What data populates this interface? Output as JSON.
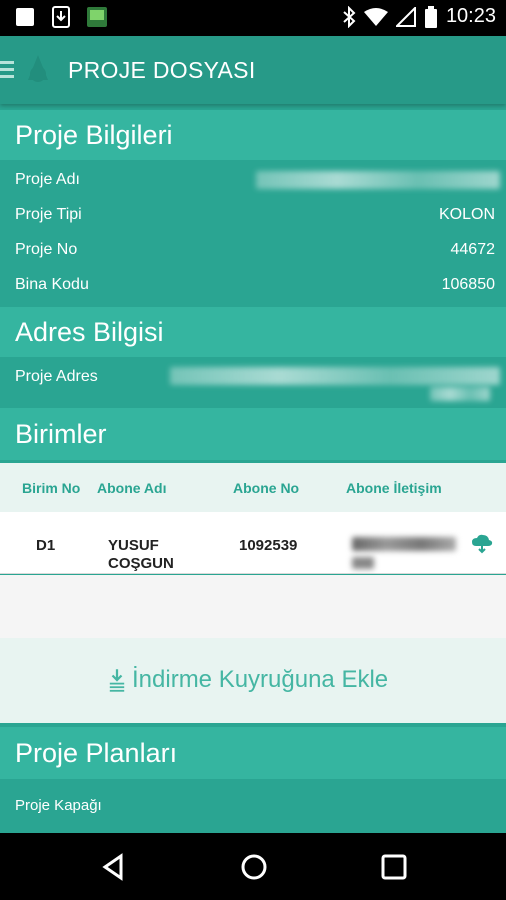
{
  "status_bar": {
    "time": "10:23"
  },
  "app_bar": {
    "title": "PROJE DOSYASI"
  },
  "project_info": {
    "header": "Proje Bilgileri",
    "rows": [
      {
        "label": "Proje Adı",
        "value": ""
      },
      {
        "label": "Proje Tipi",
        "value": "KOLON"
      },
      {
        "label": "Proje No",
        "value": "44672"
      },
      {
        "label": "Bina Kodu",
        "value": "106850"
      }
    ]
  },
  "address_info": {
    "header": "Adres Bilgisi",
    "label": "Proje Adres"
  },
  "units": {
    "header": "Birimler",
    "columns": [
      "Birim No",
      "Abone Adı",
      "Abone No",
      "Abone İletişim"
    ],
    "rows": [
      {
        "unit_no": "D1",
        "subscriber_name_1": "YUSUF",
        "subscriber_name_2": "COŞGUN",
        "subscriber_no": "1092539"
      }
    ]
  },
  "download": {
    "label": "İndirme Kuyruğuna Ekle"
  },
  "plans": {
    "header": "Proje Planları",
    "rows": [
      {
        "label": "Proje Kapağı"
      }
    ]
  },
  "colors": {
    "primary": "#2aa592",
    "header": "#35b5a0",
    "appbar": "#279a88",
    "accent": "#45b6a3"
  }
}
